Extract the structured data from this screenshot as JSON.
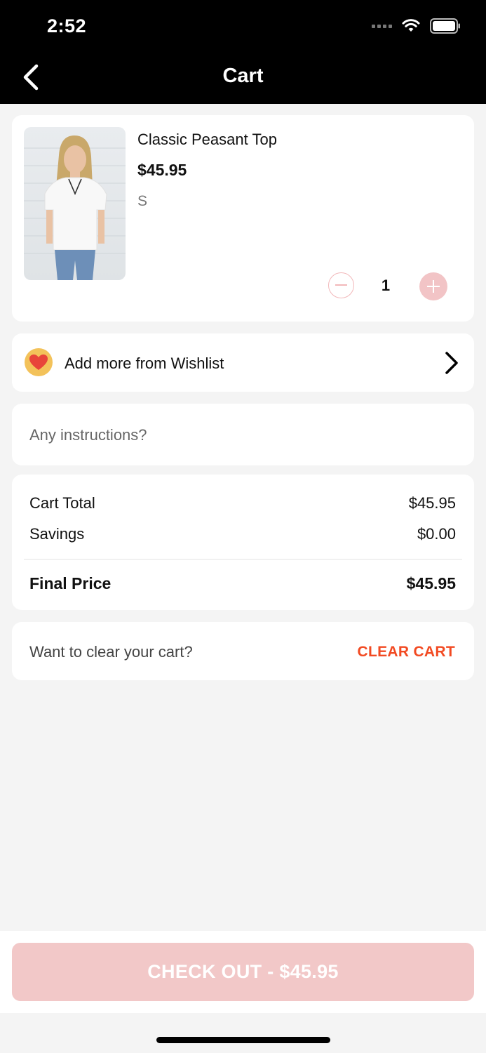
{
  "status_bar": {
    "time": "2:52"
  },
  "nav": {
    "title": "Cart"
  },
  "cart_item": {
    "name": "Classic Peasant Top",
    "price": "$45.95",
    "size": "S",
    "quantity": "1"
  },
  "wishlist": {
    "label": "Add more from Wishlist"
  },
  "instructions": {
    "placeholder": "Any instructions?"
  },
  "summary": {
    "cart_total_label": "Cart Total",
    "cart_total_value": "$45.95",
    "savings_label": "Savings",
    "savings_value": "$0.00",
    "final_price_label": "Final Price",
    "final_price_value": "$45.95"
  },
  "clear": {
    "prompt": "Want to clear your cart?",
    "button_label": "CLEAR CART"
  },
  "checkout": {
    "label": "CHECK OUT - $45.95"
  },
  "colors": {
    "accent": "#f24a22",
    "checkout_bg": "#f2c8c8",
    "header_bg": "#000000"
  }
}
